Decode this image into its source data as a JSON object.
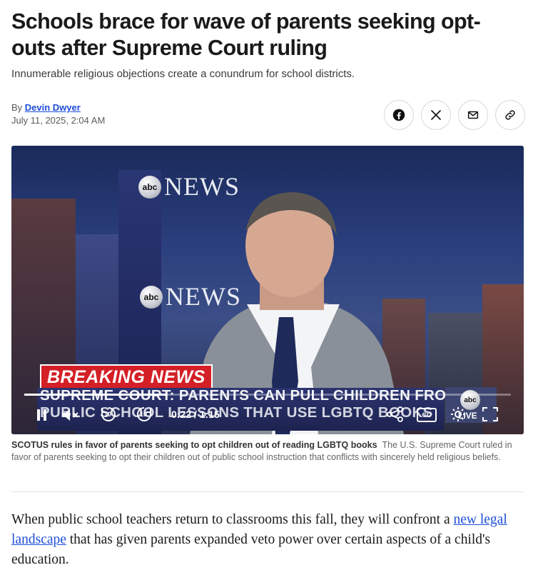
{
  "article": {
    "headline": "Schools brace for wave of parents seeking opt-outs after Supreme Court ruling",
    "subhead": "Innumerable religious objections create a conundrum for school districts.",
    "byline_prefix": "By",
    "author": "Devin Dwyer",
    "date": "July 11, 2025, 2:04 AM"
  },
  "share": {
    "icons": [
      "facebook-icon",
      "x-icon",
      "email-icon",
      "link-icon"
    ]
  },
  "video": {
    "logo_text_top": "NEWS",
    "logo_text_mid": "NEWS",
    "abc_label": "abc",
    "breaking": "BREAKING NEWS",
    "line1": "SUPREME COURT: PARENTS CAN PULL CHILDREN FROM",
    "line2": "PUBLIC SCHOOL LESSONS THAT USE LGBTQ BOOKS",
    "live": "LIVE",
    "current_time": "0:22",
    "separator": " / ",
    "duration": "1:15",
    "progress_fraction": 0.293,
    "rewind_label": "10",
    "forward_label": "10",
    "cc_label": "CC"
  },
  "caption": {
    "bold": "SCOTUS rules in favor of parents seeking to opt children out of reading LGBTQ books",
    "text": "The U.S. Supreme Court ruled in favor of parents seeking to opt their children out of public school instruction that conflicts with sincerely held religious beliefs."
  },
  "body": {
    "p1_start": "When public school teachers return to classrooms this fall, they will confront a ",
    "p1_link": "new legal landscape",
    "p1_end": " that has given parents expanded veto power over certain aspects of a child's education."
  },
  "colors": {
    "link": "#1d4ed8",
    "breaking_red": "#d41f26"
  }
}
